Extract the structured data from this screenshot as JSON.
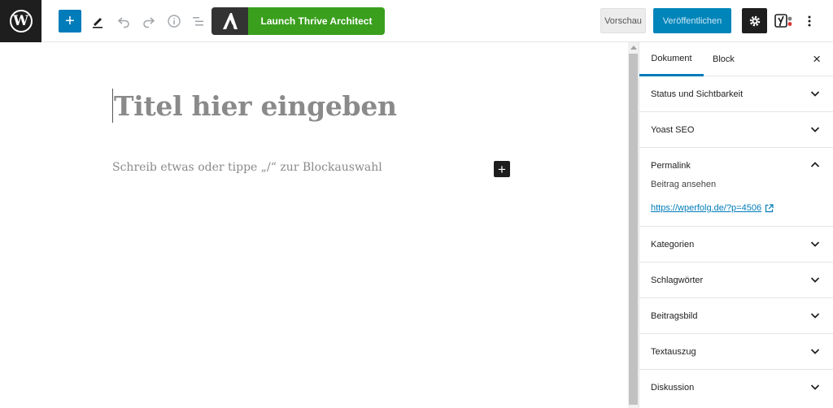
{
  "app": {
    "logo_letter": "W"
  },
  "toolbar": {
    "add_icon": "plus-icon",
    "tools_icon": "pen-icon",
    "undo_icon": "undo-icon",
    "redo_icon": "redo-icon",
    "info_icon": "info-icon",
    "outline_icon": "list-icon",
    "thrive_label": "Launch Thrive Architect",
    "preview_label": "Vorschau",
    "publish_label": "Veröffentlichen",
    "yoast_letter": "y",
    "colors": {
      "accent": "#007cba",
      "thrive_green": "#3a9f1d",
      "dark": "#1e1e1e"
    }
  },
  "editor": {
    "title_placeholder": "Titel hier eingeben",
    "body_placeholder": "Schreib etwas oder tippe „/“ zur Blockauswahl",
    "add_block_symbol": "+"
  },
  "sidebar": {
    "tabs": [
      {
        "label": "Dokument",
        "active": true
      },
      {
        "label": "Block",
        "active": false
      }
    ],
    "close_symbol": "×",
    "panels": [
      {
        "label": "Status und Sichtbarkeit",
        "expanded": false
      },
      {
        "label": "Yoast SEO",
        "expanded": false
      },
      {
        "label": "Permalink",
        "expanded": true
      },
      {
        "label": "Kategorien",
        "expanded": false
      },
      {
        "label": "Schlagwörter",
        "expanded": false
      },
      {
        "label": "Beitragsbild",
        "expanded": false
      },
      {
        "label": "Textauszug",
        "expanded": false
      },
      {
        "label": "Diskussion",
        "expanded": false
      }
    ],
    "permalink": {
      "view_label": "Beitrag ansehen",
      "url": "https://wperfolg.de/?p=4506"
    }
  }
}
